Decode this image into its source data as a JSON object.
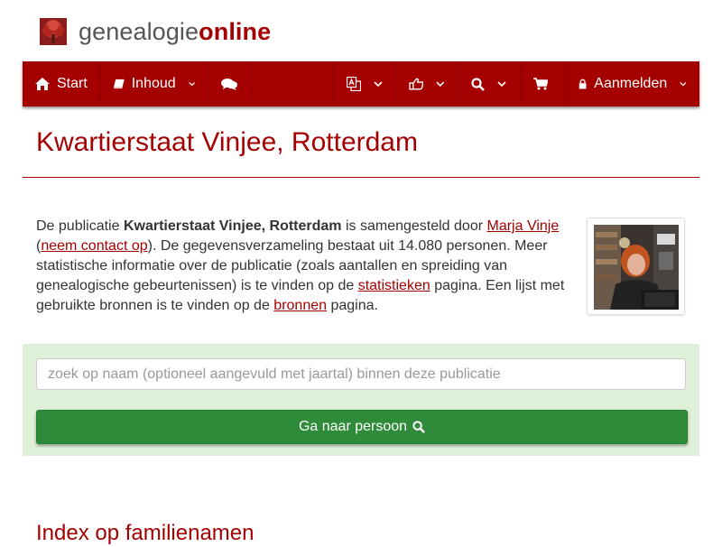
{
  "brand": {
    "part1": "genealogie",
    "part2": "online"
  },
  "nav": {
    "start": "Start",
    "inhoud": "Inhoud",
    "aanmelden": "Aanmelden"
  },
  "page": {
    "title": "Kwartierstaat Vinjee, Rotterdam"
  },
  "intro": {
    "t1": "De publicatie ",
    "pub": "Kwartierstaat Vinjee, Rotterdam",
    "t2": " is samengesteld door ",
    "author": "Marja Vinje",
    "t3": "(",
    "contact": "neem contact op",
    "t4": "). De gegevensverzameling bestaat uit 14.080 personen. Meer statistische informatie over de publicatie (zoals aantallen en spreiding van genealogische gebeurtenissen) is te vinden op de ",
    "stats": "statistieken",
    "t5": " pagina. Een lijst met gebruikte bronnen is te vinden op de ",
    "sources": "bronnen",
    "t6": " pagina."
  },
  "search": {
    "placeholder": "zoek op naam (optioneel aangevuld met jaartal) binnen deze publicatie",
    "button": "Ga naar persoon"
  },
  "sections": {
    "index_title": "Index op familienamen"
  },
  "colors": {
    "brand": "#a50000",
    "panel": "#dff0d8",
    "button": "#2e8b3a"
  }
}
